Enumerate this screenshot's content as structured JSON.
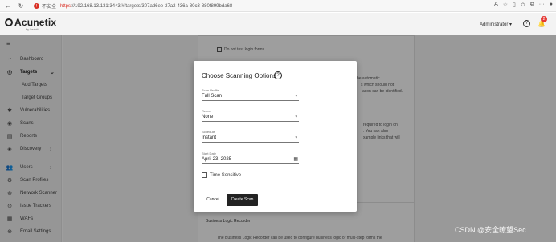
{
  "browser": {
    "insecure_label": "不安全",
    "url_https": "https",
    "url_rest": "://192.168.13.131:3443/#/targets/307ad6ee-27a2-436a-80c3-880f899bda68"
  },
  "header": {
    "logo_text": "Acunetix",
    "logo_sub": "by Invicti",
    "user": "Administrator",
    "notification_count": "2"
  },
  "sidebar": {
    "items": [
      {
        "label": "Dashboard",
        "icon": "dashboard-icon"
      },
      {
        "label": "Targets",
        "icon": "target-icon"
      },
      {
        "label": "Add Targets"
      },
      {
        "label": "Target Groups"
      },
      {
        "label": "Vulnerabilities",
        "icon": "bug-icon"
      },
      {
        "label": "Scans",
        "icon": "scan-icon"
      },
      {
        "label": "Reports",
        "icon": "report-icon"
      },
      {
        "label": "Discovery",
        "icon": "discovery-icon"
      },
      {
        "label": "Users",
        "icon": "users-icon"
      },
      {
        "label": "Scan Profiles",
        "icon": "profile-icon"
      },
      {
        "label": "Network Scanner",
        "icon": "network-icon"
      },
      {
        "label": "Issue Trackers",
        "icon": "tracker-icon"
      },
      {
        "label": "WAFs",
        "icon": "waf-icon"
      },
      {
        "label": "Email Settings",
        "icon": "email-icon"
      }
    ]
  },
  "background": {
    "do_not_test_login": "Do not test login forms",
    "text1": "ly. The automatic",
    "text2": "s which should not",
    "text3": "ason can be identified.",
    "text4": "required to login on",
    "text5": ". You can also",
    "text6": "xample links that will",
    "blr_title": "Business Logic Recorder",
    "blr_desc": "The Business Logic Recorder can be used to configure business logic or multi-step forms the"
  },
  "modal": {
    "title": "Choose Scanning Options",
    "scan_profile_label": "Scan Profile",
    "scan_profile_value": "Full Scan",
    "report_label": "Report",
    "report_value": "None",
    "schedule_label": "Schedule",
    "schedule_value": "Instant",
    "start_date_label": "Start Date",
    "start_date_value": "April 23, 2025",
    "time_sensitive_label": "Time Sensitive",
    "cancel_label": "Cancel",
    "create_label": "Create Scan"
  },
  "watermark": "CSDN @安全瞭望Sec"
}
